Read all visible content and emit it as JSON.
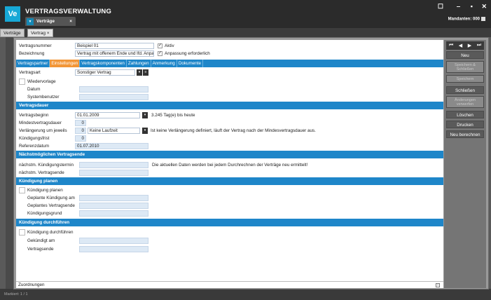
{
  "app": {
    "title": "VERTRAGSVERWALTUNG",
    "tab_label": "Verträge",
    "tab_close": "×",
    "logo": "Ve",
    "mandant": "Mandanten: 000",
    "window_controls": [
      "☐",
      "‒",
      "▪",
      "✕"
    ]
  },
  "doc_tabs": [
    "Verträge",
    "Vertrag ×"
  ],
  "header": {
    "vertragsnummer_label": "Vertragsnummer",
    "vertragsnummer_value": "Beispiel 01",
    "bezeichnung_label": "Bezeichnung",
    "bezeichnung_value": "Vertrag mit offenem Ende und lfd. Anpassung",
    "aktiv_label": "Aktiv",
    "aktiv_checked": true,
    "anpassung_label": "Anpassung erforderlich",
    "anpassung_checked": true
  },
  "subtabs": [
    {
      "label": "Vertragspartner",
      "active": false
    },
    {
      "label": "Einstellungen",
      "active": true
    },
    {
      "label": "Vertragskomponenten",
      "active": false
    },
    {
      "label": "Zahlungen",
      "active": false
    },
    {
      "label": "Anmerkung",
      "active": false
    },
    {
      "label": "Dokumente",
      "active": false
    }
  ],
  "general": {
    "vertragsart_label": "Vertragsart",
    "vertragsart_value": "Sonstiger Vertrag",
    "wiedervorlage_label": "Wiedervorlage",
    "datum_label": "Datum",
    "systembenutzer_label": "Systembenutzer"
  },
  "dauer": {
    "section": "Vertragsdauer",
    "beginn_label": "Vertragsbeginn",
    "beginn_value": "01.01.2009",
    "beginn_info": "3.245 Tag(e) bis heute",
    "mindest_label": "Mindestvertragsdauer",
    "mindest_value": "0",
    "verl_label": "Verlängerung um jeweils",
    "verl_num": "0",
    "verl_value": "Keine Laufzeit",
    "verl_info": "Ist keine Verlängerung definiert, läuft der Vertrag nach der Mindesvertragsdauer aus.",
    "frist_label": "Kündigungsfrist",
    "frist_value": "0",
    "ref_label": "Referenzdatum",
    "ref_value": "01.07.2010"
  },
  "naechst": {
    "section": "Nächstmöglichen Vertragsende",
    "termin_label": "nächstm. Kündigungstermin",
    "ende_label": "nächstm. Vertragsende",
    "info": "Die aktuellen Daten werden bei jedem Durchrechnen der Verträge neu ermittelt!"
  },
  "planen": {
    "section": "Kündigung planen",
    "cb_label": "Kündigung planen",
    "am_label": "Geplante Kündigung am",
    "ende_label": "Geplantes Vertragsende",
    "grund_label": "Kündigungsgrund"
  },
  "durch": {
    "section": "Kündigung durchführen",
    "cb_label": "Kündigung durchführen",
    "am_label": "Gekündigt am",
    "ende_label": "Vertragsende"
  },
  "footer": {
    "zuordnungen": "Zuordnungen",
    "status": "Markiert: 1 / 1"
  },
  "sidebar": {
    "nav": [
      "⏮",
      "◀",
      "▶",
      "⏭"
    ],
    "buttons": [
      {
        "label": "Neu",
        "enabled": true
      },
      {
        "label": "Speichern & Schließen",
        "enabled": false
      },
      {
        "label": "Speichern",
        "enabled": false
      },
      {
        "label": "Schließen",
        "enabled": true
      },
      {
        "label": "Änderungen verwerfen",
        "enabled": false
      },
      {
        "label": "Löschen",
        "enabled": true
      },
      {
        "label": "Drucken",
        "enabled": true
      },
      {
        "label": "Neu berechnen",
        "enabled": true
      }
    ]
  },
  "colors": {
    "accent": "#1e86c9",
    "active_tab": "#f29637",
    "field": "#dde9f5"
  }
}
